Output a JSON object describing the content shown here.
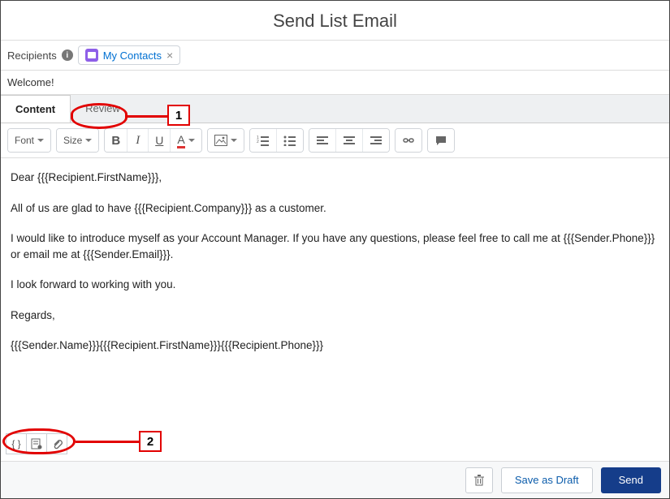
{
  "header": {
    "title": "Send List Email"
  },
  "recipients": {
    "label": "Recipients",
    "chip_label": "My Contacts"
  },
  "subject": {
    "text": "Welcome!"
  },
  "tabs": {
    "content": "Content",
    "review": "Review"
  },
  "toolbar": {
    "font_label": "Font",
    "size_label": "Size"
  },
  "callouts": {
    "one": "1",
    "two": "2"
  },
  "body": {
    "p1": "Dear {{{Recipient.FirstName}}},",
    "p2": "All of us are glad to have {{{Recipient.Company}}} as a customer.",
    "p3": "I would like to introduce myself as your Account Manager.  If you have any questions, please feel free to call me at {{{Sender.Phone}}} or email me at {{{Sender.Email}}}.",
    "p4": "I look forward to working with you.",
    "p5": "Regards,",
    "p6": "{{{Sender.Name}}}{{{Recipient.FirstName}}}{{{Recipient.Phone}}}"
  },
  "bottom_tools": {
    "merge": "{ }"
  },
  "footer": {
    "save_draft": "Save as Draft",
    "send": "Send"
  }
}
